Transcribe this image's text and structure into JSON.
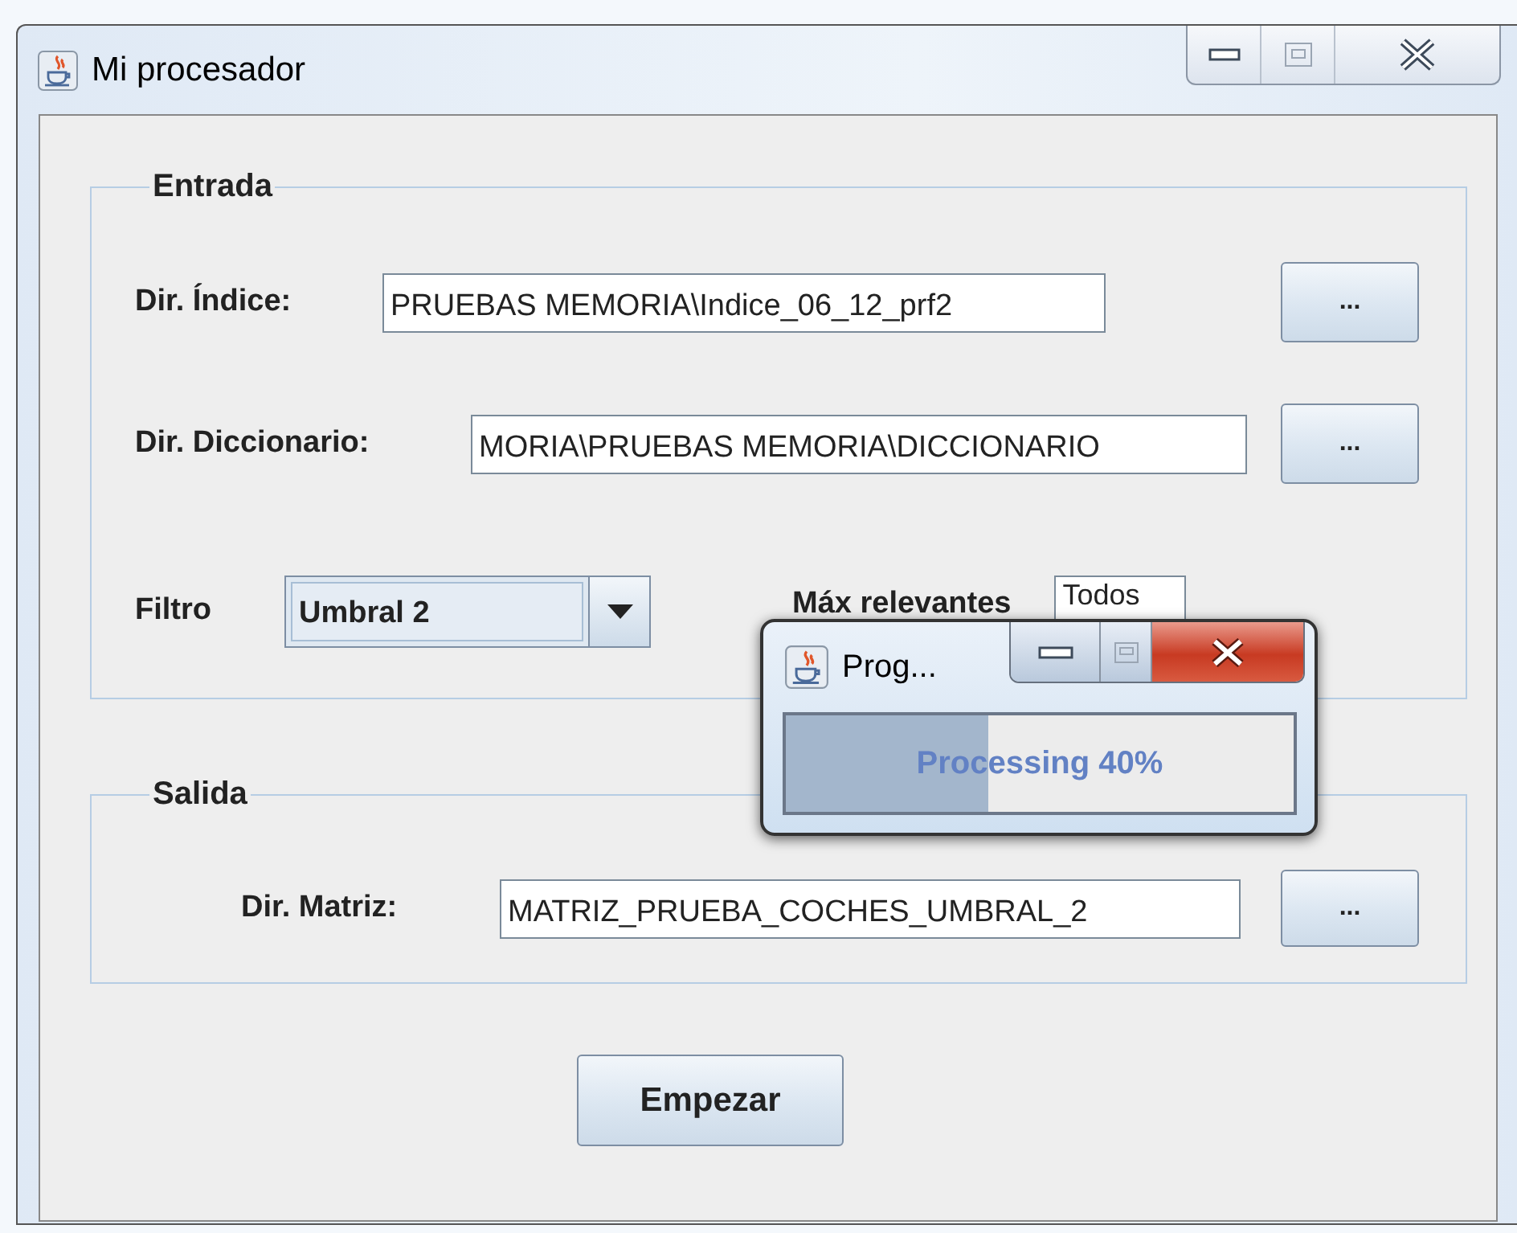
{
  "window": {
    "title": "Mi procesador"
  },
  "entrada": {
    "legend": "Entrada",
    "rows": [
      {
        "label": "Dir. Índice:",
        "value": "PRUEBAS MEMORIA\\Indice_06_12_prf2",
        "button": "..."
      },
      {
        "label": "Dir. Diccionario:",
        "value": "MORIA\\PRUEBAS MEMORIA\\DICCIONARIO",
        "button": "..."
      }
    ],
    "filtro": {
      "label": "Filtro",
      "value": "Umbral 2"
    },
    "max_relevantes": {
      "label": "Máx relevantes",
      "value": "Todos"
    }
  },
  "salida": {
    "legend": "Salida",
    "label": "Dir. Matriz:",
    "value": "MATRIZ_PRUEBA_COCHES_UMBRAL_2",
    "button": "..."
  },
  "start_button": "Empezar",
  "progress_dialog": {
    "title": "Prog...",
    "level": 0.4,
    "text": "Processing 40%"
  }
}
